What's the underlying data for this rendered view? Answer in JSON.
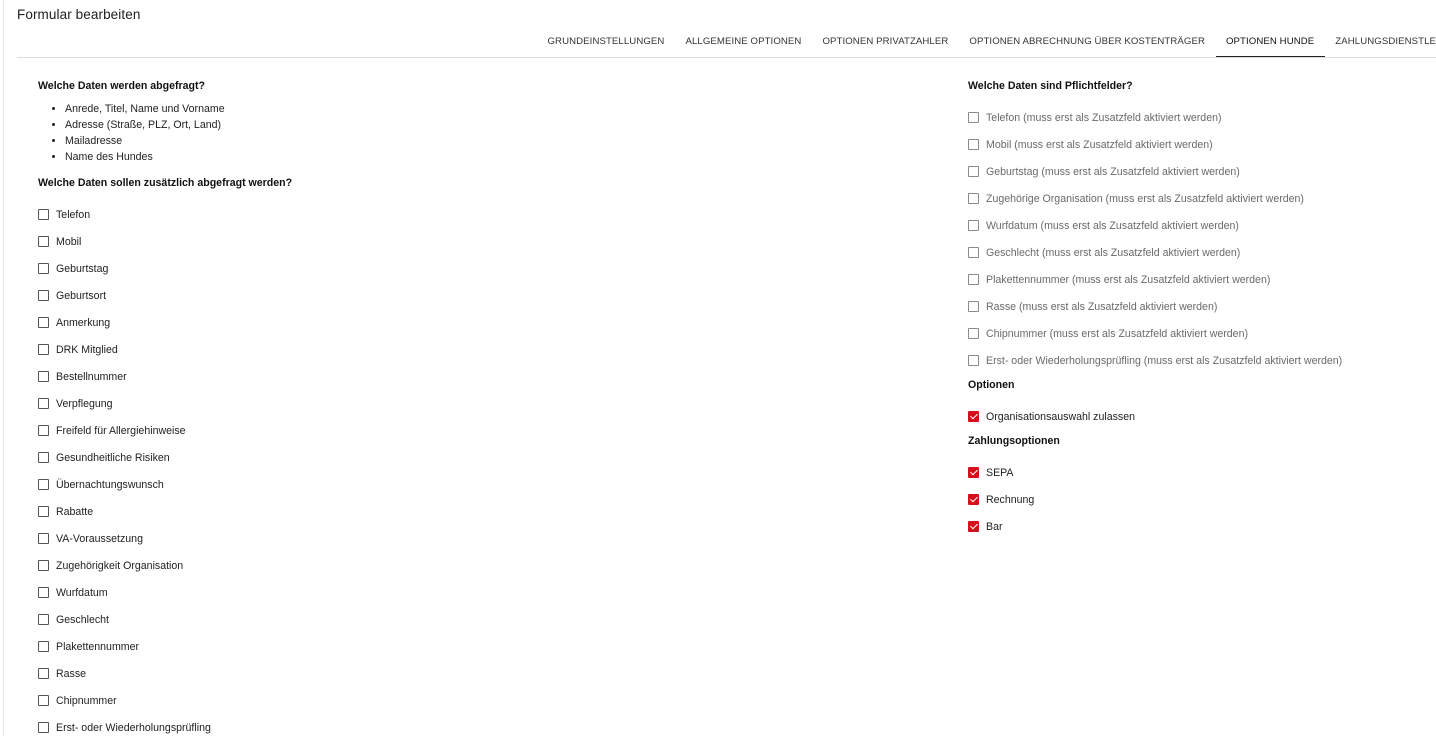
{
  "page": {
    "title": "Formular bearbeiten"
  },
  "tabs": [
    {
      "label": "GRUNDEINSTELLUNGEN",
      "active": false
    },
    {
      "label": "ALLGEMEINE OPTIONEN",
      "active": false
    },
    {
      "label": "OPTIONEN PRIVATZAHLER",
      "active": false
    },
    {
      "label": "OPTIONEN ABRECHNUNG ÜBER KOSTENTRÄGER",
      "active": false
    },
    {
      "label": "OPTIONEN HUNDE",
      "active": true
    },
    {
      "label": "ZAHLUNGSDIENSTLEISTER",
      "active": false
    }
  ],
  "left": {
    "queried_heading": "Welche Daten werden abgefragt?",
    "queried_items": [
      "Anrede, Titel, Name und Vorname",
      "Adresse (Straße, PLZ, Ort, Land)",
      "Mailadresse",
      "Name des Hundes"
    ],
    "additional_heading": "Welche Daten sollen zusätzlich abgefragt werden?",
    "additional_fields": [
      {
        "label": "Telefon",
        "checked": false
      },
      {
        "label": "Mobil",
        "checked": false
      },
      {
        "label": "Geburtstag",
        "checked": false
      },
      {
        "label": "Geburtsort",
        "checked": false
      },
      {
        "label": "Anmerkung",
        "checked": false
      },
      {
        "label": "DRK Mitglied",
        "checked": false
      },
      {
        "label": "Bestellnummer",
        "checked": false
      },
      {
        "label": "Verpflegung",
        "checked": false
      },
      {
        "label": "Freifeld für Allergiehinweise",
        "checked": false
      },
      {
        "label": "Gesundheitliche Risiken",
        "checked": false
      },
      {
        "label": "Übernachtungswunsch",
        "checked": false
      },
      {
        "label": "Rabatte",
        "checked": false
      },
      {
        "label": "VA-Voraussetzung",
        "checked": false
      },
      {
        "label": "Zugehörigkeit Organisation",
        "checked": false
      },
      {
        "label": "Wurfdatum",
        "checked": false
      },
      {
        "label": "Geschlecht",
        "checked": false
      },
      {
        "label": "Plakettennummer",
        "checked": false
      },
      {
        "label": "Rasse",
        "checked": false
      },
      {
        "label": "Chipnummer",
        "checked": false
      },
      {
        "label": "Erst- oder Wiederholungsprüfling",
        "checked": false
      }
    ]
  },
  "right": {
    "required_heading": "Welche Daten sind Pflichtfelder?",
    "required_fields": [
      {
        "label": "Telefon (muss erst als Zusatzfeld aktiviert werden)",
        "checked": false
      },
      {
        "label": "Mobil (muss erst als Zusatzfeld aktiviert werden)",
        "checked": false
      },
      {
        "label": "Geburtstag (muss erst als Zusatzfeld aktiviert werden)",
        "checked": false
      },
      {
        "label": "Zugehörige Organisation (muss erst als Zusatzfeld aktiviert werden)",
        "checked": false
      },
      {
        "label": "Wurfdatum (muss erst als Zusatzfeld aktiviert werden)",
        "checked": false
      },
      {
        "label": "Geschlecht (muss erst als Zusatzfeld aktiviert werden)",
        "checked": false
      },
      {
        "label": "Plakettennummer (muss erst als Zusatzfeld aktiviert werden)",
        "checked": false
      },
      {
        "label": "Rasse (muss erst als Zusatzfeld aktiviert werden)",
        "checked": false
      },
      {
        "label": "Chipnummer (muss erst als Zusatzfeld aktiviert werden)",
        "checked": false
      },
      {
        "label": "Erst- oder Wiederholungsprüfling (muss erst als Zusatzfeld aktiviert werden)",
        "checked": false
      }
    ],
    "options_heading": "Optionen",
    "options": [
      {
        "label": "Organisationsauswahl zulassen",
        "checked": true
      }
    ],
    "payment_heading": "Zahlungsoptionen",
    "payment_options": [
      {
        "label": "SEPA",
        "checked": true
      },
      {
        "label": "Rechnung",
        "checked": true
      },
      {
        "label": "Bar",
        "checked": true
      }
    ]
  },
  "colors": {
    "accent": "#d4101c",
    "active_tab_indicator": "#222222",
    "divider": "#dcdcdc"
  }
}
